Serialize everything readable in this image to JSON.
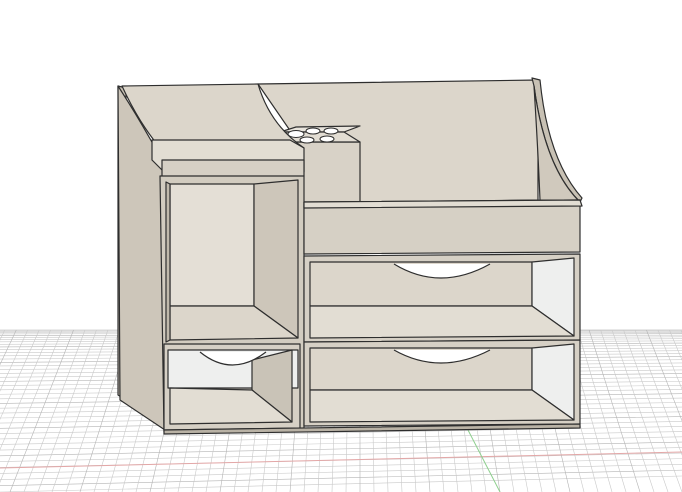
{
  "viewport": {
    "background": "#ffffff",
    "grid_color": "#c9c9c9",
    "grid_major_color": "#b4b4b4",
    "axis_x_color": "#e3a7a7",
    "axis_y_color": "#8fd08f"
  },
  "model": {
    "name": "desk-organizer",
    "colors": {
      "wood_front": "#d6d0c5",
      "wood_top": "#e2ddd3",
      "wood_side": "#c8c1b4",
      "wood_inner": "#dcd6cb",
      "wood_shadow": "#b9b2a5",
      "glass": "#eeefee",
      "edge": "#2e2e2e"
    }
  }
}
